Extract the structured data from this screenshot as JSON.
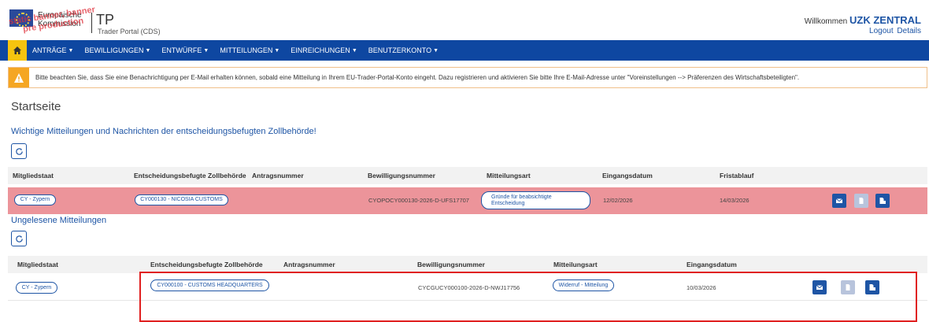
{
  "header": {
    "ec_text_line1": "Europäische",
    "ec_text_line2": "Kommission",
    "static_banner": "static banner, banner pre production",
    "app_title": "TP",
    "app_subtitle": "Trader Portal (CDS)",
    "welcome_prefix": "Willkommen",
    "user_name": "UZK ZENTRAL",
    "logout": "Logout",
    "details": "Details"
  },
  "nav": {
    "items": [
      "ANTRÄGE",
      "BEWILLIGUNGEN",
      "ENTWÜRFE",
      "MITTEILUNGEN",
      "EINREICHUNGEN",
      "BENUTZERKONTO"
    ]
  },
  "warning": {
    "text": "Bitte beachten Sie, dass Sie eine Benachrichtigung per E-Mail erhalten können, sobald eine Mitteilung in Ihrem EU-Trader-Portal-Konto eingeht. Dazu registrieren und aktivieren Sie bitte Ihre E-Mail-Adresse unter \"Voreinstellungen --> Präferenzen des Wirtschaftsbeteiligten\"."
  },
  "page_title": "Startseite",
  "important": {
    "title": "Wichtige Mitteilungen und Nachrichten der entscheidungsbefugten Zollbehörde!",
    "headers": {
      "member_state": "Mitgliedstaat",
      "authority": "Entscheidungsbefugte Zollbehörde",
      "application": "Antragsnummer",
      "authorisation": "Bewilligungsnummer",
      "type": "Mitteilungsart",
      "received": "Eingangsdatum",
      "deadline": "Fristablauf"
    },
    "row": {
      "member_state": "CY - Zypern",
      "authority": "CY000130 - NICOSIA CUSTOMS",
      "application": "",
      "authorisation": "CYOPOCY000130-2026-D-UFS17707",
      "type": "Gründe für beabsichtigte Entscheidung",
      "received": "12/02/2026",
      "deadline": "14/03/2026"
    }
  },
  "unread": {
    "title": "Ungelesene Mitteilungen",
    "headers": {
      "member_state": "Mitgliedstaat",
      "authority": "Entscheidungsbefugte Zollbehörde",
      "application": "Antragsnummer",
      "authorisation": "Bewilligungsnummer",
      "type": "Mitteilungsart",
      "received": "Eingangsdatum"
    },
    "row": {
      "member_state": "CY - Zypern",
      "authority": "CY000100 - CUSTOMS HEADQUARTERS",
      "application": "",
      "authorisation": "CYCGUCY000100-2026-D-NWJ17756",
      "type": "Widerruf - Mitteilung",
      "received": "10/03/2026"
    }
  },
  "colors": {
    "primary": "#1e55a5",
    "nav_bg": "#0e47a1",
    "highlight_row": "#ec949a",
    "warning": "#f5a623",
    "home": "#f6c40f",
    "annotation_box": "#e02020"
  },
  "icons": [
    "home-icon",
    "warning-icon",
    "refresh-icon",
    "mail-icon",
    "document-icon",
    "download-document-icon"
  ]
}
